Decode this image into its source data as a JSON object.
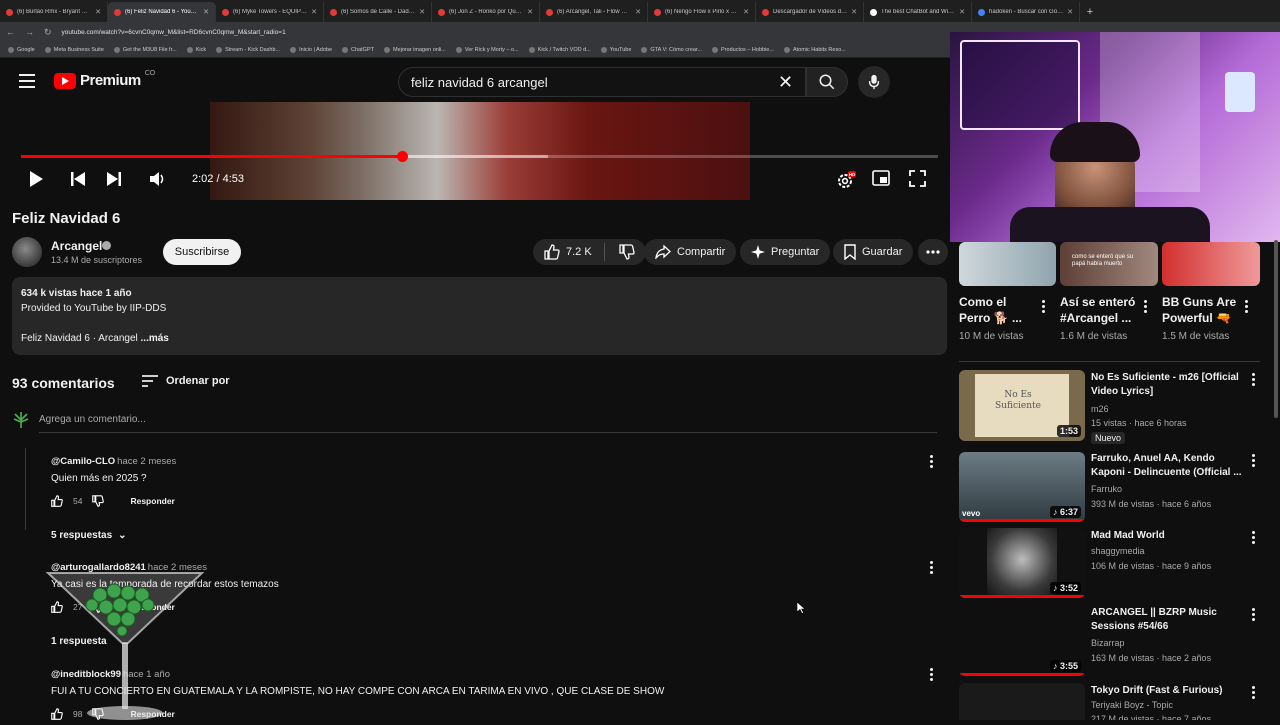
{
  "browser": {
    "tabs": [
      {
        "label": "(6) Burlao Rmx - Bryant Myers"
      },
      {
        "label": "(6) Feliz Navidad 6 - YouTube",
        "active": true
      },
      {
        "label": "(6) Myke Towers - EQUIPO DE..."
      },
      {
        "label": "(6) Somos de Calle - Daddy Ya..."
      },
      {
        "label": "(6) Jon Z - Ronko por Que Pue..."
      },
      {
        "label": "(6) Arcángel, Tali - Flow Cabr..."
      },
      {
        "label": "(6) Ñengo Flow x Pirlo x Estel..."
      },
      {
        "label": "Descargador de Vídeos de Yo..."
      },
      {
        "label": "The best ChatBot and Widget..."
      },
      {
        "label": "hadoken - Buscar con Google"
      }
    ],
    "url": "youtube.com/watch?v=6cvnC0qmw_M&list=RD6cvnC0qmw_M&start_radio=1",
    "bookmarks": [
      "Google",
      "Meta Business Suite",
      "Get the M3U8 File fr...",
      "Kick",
      "Stream - Kick Dashb...",
      "Inicio | Adobe",
      "ChatGPT",
      "Mejorar imagen onli...",
      "Ver Rick y Morty – o...",
      "Kick / Twitch VOD d...",
      "YouTube",
      "GTA V: Cómo crear...",
      "Productos – Hobbie...",
      "Atomic Habits Reso..."
    ]
  },
  "header": {
    "logo_text": "Premium",
    "country": "CO",
    "search_value": "feliz navidad 6 arcangel"
  },
  "player": {
    "time": "2:02 / 4:53",
    "progress_played": 0.416,
    "progress_loaded": 0.575,
    "accent": "#ff0000",
    "settings_badge": "HD"
  },
  "video": {
    "title": "Feliz Navidad 6",
    "channel": "Arcangel",
    "subscribers": "13.4 M de suscriptores",
    "subscribe_label": "Suscribirse",
    "likes": "7.2 K",
    "share_label": "Compartir",
    "ask_label": "Preguntar",
    "save_label": "Guardar"
  },
  "description": {
    "stats": "634 k vistas  hace 1 año",
    "line2": "Provided to YouTube by IIP-DDS",
    "line3": "Feliz Navidad 6 · Arcangel",
    "more": "...más"
  },
  "comments": {
    "count_label": "93 comentarios",
    "sort_label": "Ordenar por",
    "add_placeholder": "Agrega un comentario...",
    "reply_label": "Responder",
    "items": [
      {
        "author": "@Camilo-CLO",
        "ago": "hace 2 meses",
        "text": "Quien más en 2025 ?",
        "likes": "54",
        "replies": "5 respuestas"
      },
      {
        "author": "@arturogallardo8241",
        "ago": "hace 2 meses",
        "text": "Ya casi es la temporada de recordar estos temazos",
        "likes": "27",
        "replies": "1 respuesta"
      },
      {
        "author": "@ineditblock99",
        "ago": "hace 1 año",
        "text": "FUI A TU CONCIERTO EN GUATEMALA Y LA ROMPISTE, NO HAY COMPE CON ARCA EN TARIMA EN VIVO , QUE CLASE DE SHOW",
        "likes": "98"
      }
    ]
  },
  "sidebar": {
    "top_row": [
      {
        "title_line1": "Como el",
        "title_line2": "Perro 🐕 ...",
        "views": "10 M de vistas"
      },
      {
        "title_line1": "Así se enteró",
        "title_line2": "#Arcangel ...",
        "views": "1.6 M de vistas",
        "thumb_caption": "como se enteró que su papá había muerto"
      },
      {
        "title_line1": "BB Guns Are",
        "title_line2": "Powerful 🔫",
        "views": "1.5 M de vistas"
      }
    ],
    "videos": [
      {
        "title": "No Es Suficiente - m26 [Official Video Lyrics]",
        "channel": "m26",
        "meta": "15 vistas · hace 6 horas",
        "duration": "1:53",
        "badge": "Nuevo",
        "thumb_text": "No Es Suficiente"
      },
      {
        "title": "Farruko, Anuel AA, Kendo Kaponi - Delincuente (Official ...",
        "channel": "Farruko",
        "meta": "393 M de vistas · hace 6 años",
        "duration": "6:37",
        "thumb_text": "vevo"
      },
      {
        "title": "Mad Mad World",
        "channel": "shaggymedia",
        "meta": "106 M de vistas · hace 9 años",
        "duration": "3:52"
      },
      {
        "title": "ARCANGEL || BZRP Music Sessions #54/66",
        "channel": "Bizarrap",
        "meta": "163 M de vistas · hace 2 años",
        "duration": "3:55"
      },
      {
        "title": "Tokyo Drift (Fast & Furious)",
        "channel": "Teriyaki Boyz - Topic",
        "meta": "217 M de vistas · hace 7 años"
      }
    ]
  }
}
